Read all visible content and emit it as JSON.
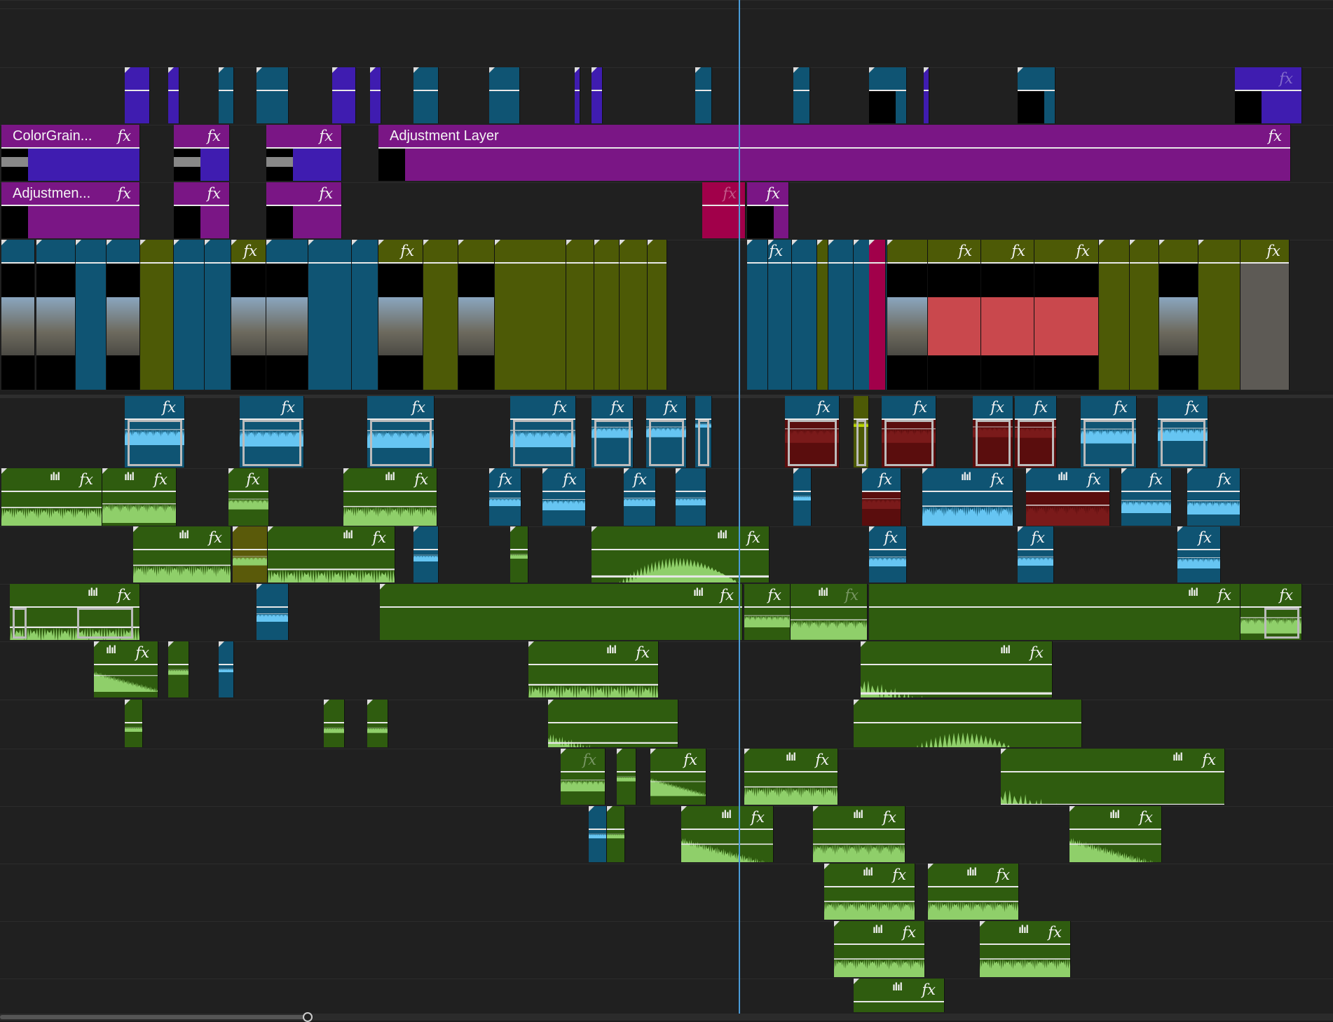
{
  "timeline": {
    "fx_label": "fx",
    "audio_glyph": "ılıl",
    "clip_names": {
      "color_grain": "ColorGrain...",
      "adjustment_short": "Adjustmen...",
      "adjustment_layer": "Adjustment Layer"
    },
    "colors": {
      "bg": "#1e1e1e",
      "track": "#202020",
      "adjustment_purple": "#7a1685",
      "fx_violet": "#3f1cb0",
      "video_teal": "#0f5473",
      "video_olive": "#4d5a06",
      "audio_green": "#2f5c0f",
      "audio_wave": "#8fcf6a",
      "audio_blue": "#66c5f2",
      "audio_red": "#5a0d0d",
      "magenta": "#a1004a",
      "playhead": "#4a9bd8"
    }
  }
}
